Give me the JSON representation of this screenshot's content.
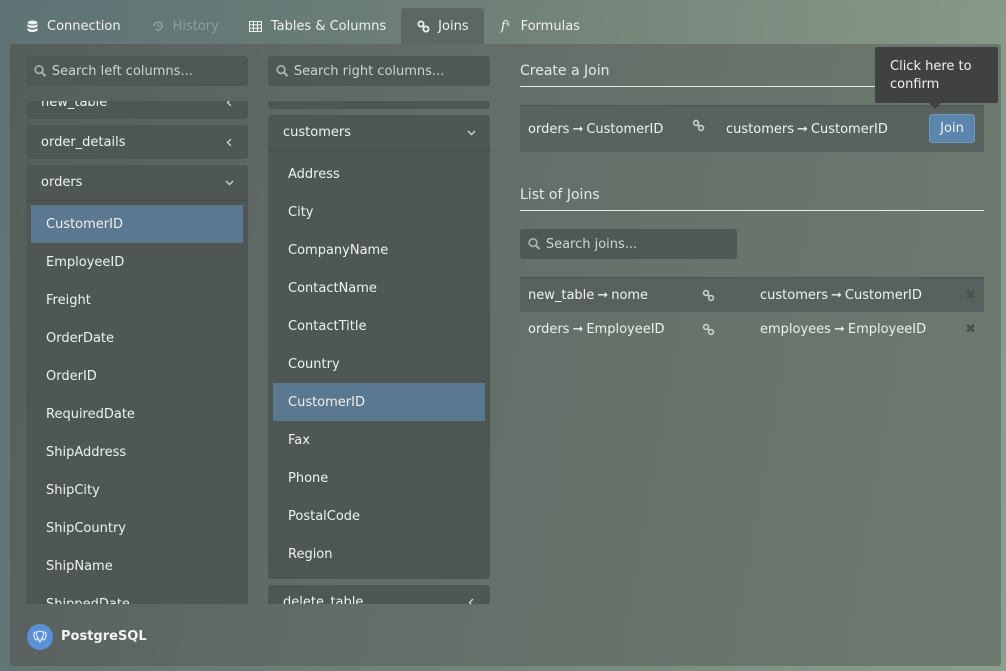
{
  "tabs": [
    {
      "label": "Connection",
      "icon": "database-icon",
      "state": "normal"
    },
    {
      "label": "History",
      "icon": "history-icon",
      "state": "disabled"
    },
    {
      "label": "Tables & Columns",
      "icon": "table-icon",
      "state": "normal"
    },
    {
      "label": "Joins",
      "icon": "link-icon",
      "state": "active"
    },
    {
      "label": "Formulas",
      "icon": "function-icon",
      "state": "normal"
    }
  ],
  "left": {
    "search_placeholder": "Search left columns...",
    "tables": [
      {
        "name": "new_table",
        "open": false
      },
      {
        "name": "order_details",
        "open": false
      },
      {
        "name": "orders",
        "open": true
      }
    ],
    "columns": [
      "CustomerID",
      "EmployeeID",
      "Freight",
      "OrderDate",
      "OrderID",
      "RequiredDate",
      "ShipAddress",
      "ShipCity",
      "ShipCountry",
      "ShipName",
      "ShippedDate"
    ],
    "selected": "CustomerID"
  },
  "right": {
    "search_placeholder": "Search right columns...",
    "tables": [
      {
        "name": "customers",
        "open": true
      },
      {
        "name": "delete_table",
        "open": false
      }
    ],
    "columns": [
      "Address",
      "City",
      "CompanyName",
      "ContactName",
      "ContactTitle",
      "Country",
      "CustomerID",
      "Fax",
      "Phone",
      "PostalCode",
      "Region"
    ],
    "selected": "CustomerID"
  },
  "create": {
    "title": "Create a Join",
    "left_table": "orders",
    "left_column": "CustomerID",
    "right_table": "customers",
    "right_column": "CustomerID",
    "join_label": "Join",
    "tooltip": "Click here to confirm"
  },
  "list": {
    "title": "List of Joins",
    "search_placeholder": "Search joins...",
    "joins": [
      {
        "left_table": "new_table",
        "left_column": "nome",
        "right_table": "customers",
        "right_column": "CustomerID"
      },
      {
        "left_table": "orders",
        "left_column": "EmployeeID",
        "right_table": "employees",
        "right_column": "EmployeeID"
      }
    ]
  },
  "arrow": "➞",
  "footer": {
    "db_name": "PostgreSQL"
  }
}
